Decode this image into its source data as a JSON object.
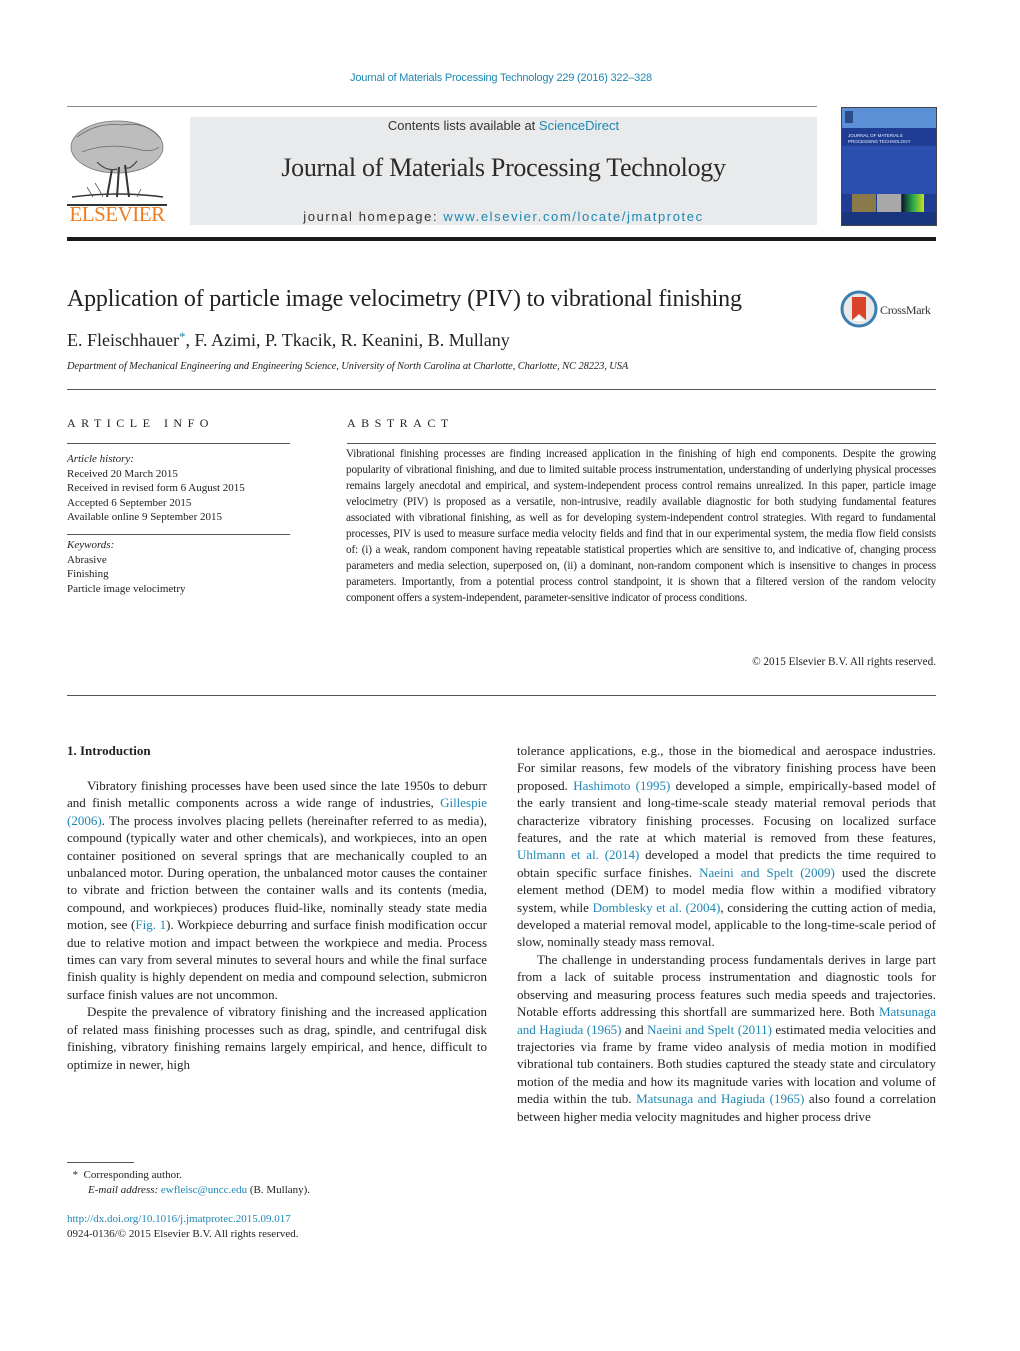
{
  "header": {
    "journal_reference": "Journal of Materials Processing Technology 229 (2016) 322–328",
    "contents_prefix": "Contents lists available at ",
    "contents_link": "ScienceDirect",
    "journal_title": "Journal of Materials Processing Technology",
    "homepage_prefix": "journal homepage: ",
    "homepage_link": "www.elsevier.com/locate/jmatprotec",
    "publisher_logo_text": "ELSEVIER",
    "cover_title": "JOURNAL OF MATERIALS PROCESSING TECHNOLOGY"
  },
  "article": {
    "title": "Application of particle image velocimetry (PIV) to vibrational finishing",
    "crossmark_label": "CrossMark",
    "authors_first": "E. Fleischhauer",
    "authors_star": "*",
    "authors_rest": ", F. Azimi, P. Tkacik, R. Keanini, B. Mullany",
    "affiliation": "Department of Mechanical Engineering and Engineering Science, University of North Carolina at Charlotte, Charlotte, NC 28223, USA"
  },
  "article_info": {
    "label": "ARTICLE INFO",
    "history_heading": "Article history:",
    "history": [
      "Received 20 March 2015",
      "Received in revised form 6 August 2015",
      "Accepted 6 September 2015",
      "Available online 9 September 2015"
    ],
    "keywords_heading": "Keywords:",
    "keywords": [
      "Abrasive",
      "Finishing",
      "Particle image velocimetry"
    ]
  },
  "abstract": {
    "label": "ABSTRACT",
    "text": "Vibrational finishing processes are finding increased application in the finishing of high end components. Despite the growing popularity of vibrational finishing, and due to limited suitable process instrumentation, understanding of underlying physical processes remains largely anecdotal and empirical, and system-independent process control remains unrealized. In this paper, particle image velocimetry (PIV) is proposed as a versatile, non-intrusive, readily available diagnostic for both studying fundamental features associated with vibrational finishing, as well as for developing system-independent control strategies. With regard to fundamental processes, PIV is used to measure surface media velocity fields and find that in our experimental system, the media flow field consists of: (i) a weak, random component having repeatable statistical properties which are sensitive to, and indicative of, changing process parameters and media selection, superposed on, (ii) a dominant, non-random component which is insensitive to changes in process parameters. Importantly, from a potential process control standpoint, it is shown that a filtered version of the random velocity component offers a system-independent, parameter-sensitive indicator of process conditions.",
    "copyright": "© 2015 Elsevier B.V. All rights reserved."
  },
  "introduction": {
    "heading": "1.  Introduction",
    "p1": {
      "a": "Vibratory finishing processes have been used since the late 1950s to deburr and finish metallic components across a wide range of industries, ",
      "link1": "Gillespie (2006)",
      "b": ". The process involves placing pellets (hereinafter referred to as media), compound (typically water and other chemicals), and workpieces, into an open container positioned on several springs that are mechanically coupled to an unbalanced motor. During operation, the unbalanced motor causes the container to vibrate and friction between the container walls and its contents (media, compound, and workpieces) produces fluid-like, nominally steady state media motion, see (",
      "link2": "Fig. 1",
      "c": "). Workpiece deburring and surface finish modification occur due to relative motion and impact between the workpiece and media. Process times can vary from several minutes to several hours and while the final surface finish quality is highly dependent on media and compound selection, submicron surface finish values are not uncommon."
    },
    "p2": {
      "a": "Despite the prevalence of vibratory finishing and the increased application of related mass finishing processes such as drag, spindle, and centrifugal disk finishing, vibratory finishing remains largely empirical, and hence, difficult to optimize in newer, high tolerance applications, e.g., those in the biomedical and aerospace industries. For similar reasons, few models of the vibratory finishing process have been proposed. ",
      "link1": "Hashimoto (1995)",
      "b": " developed a simple, empirically-based model of the early transient and long-time-scale steady material removal periods that characterize vibratory finishing processes. Focusing on localized surface features, and the rate at which material is removed from these features, ",
      "link2": "Uhlmann et al. (2014)",
      "c": " developed a model that predicts the time required to obtain specific surface finishes. ",
      "link3": "Naeini and Spelt (2009)",
      "d": " used the discrete element method (DEM) to model media flow within a modified vibratory system, while ",
      "link4": "Domblesky et al. (2004)",
      "e": ", considering the cutting action of media, developed a material removal model, applicable to the long-time-scale period of slow, nominally steady mass removal."
    },
    "p3": {
      "a": "The challenge in understanding process fundamentals derives in large part from a lack of suitable process instrumentation and diagnostic tools for observing and measuring process features such media speeds and trajectories. Notable efforts addressing this shortfall are summarized here. Both ",
      "link1": "Matsunaga and Hagiuda (1965)",
      "b": " and ",
      "link2": "Naeini and Spelt (2011)",
      "c": " estimated media velocities and trajectories via frame by frame video analysis of media motion in modified vibrational tub containers. Both studies captured the steady state and circulatory motion of the media and how its magnitude varies with location and volume of media within the tub. ",
      "link3": "Matsunaga and Hagiuda (1965)",
      "d": " also found a correlation between higher media velocity magnitudes and higher process drive"
    }
  },
  "footnote": {
    "star": "*",
    "corresponding": "Corresponding author.",
    "email_label": "E-mail address: ",
    "email": "ewfleisc@uncc.edu",
    "email_suffix": " (B. Mullany).",
    "doi": "http://dx.doi.org/10.1016/j.jmatprotec.2015.09.017",
    "issn_copyright": "0924-0136/© 2015 Elsevier B.V. All rights reserved."
  },
  "colors": {
    "link": "#1e87b3",
    "elsevier_orange": "#f07c1e",
    "masthead_bg": "#e9eaeb",
    "cover_blue": "#1f3e93"
  }
}
